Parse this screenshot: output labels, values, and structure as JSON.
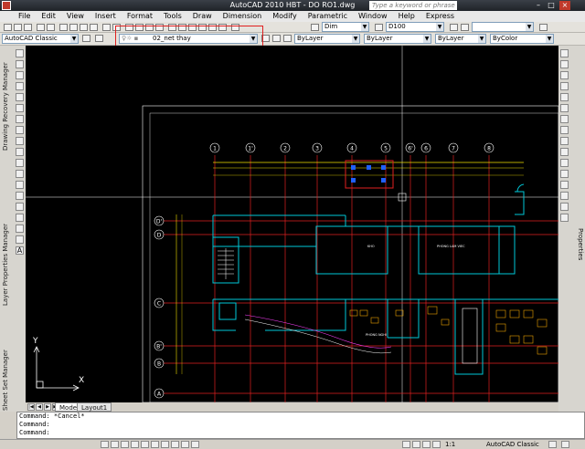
{
  "window": {
    "title": "AutoCAD 2010     HBT - DO RO1.dwg",
    "search_placeholder": "Type a keyword or phrase"
  },
  "menu": [
    "File",
    "Edit",
    "View",
    "Insert",
    "Format",
    "Tools",
    "Draw",
    "Dimension",
    "Modify",
    "Parametric",
    "Window",
    "Help",
    "Express"
  ],
  "toolbar": {
    "workspace": "AutoCAD Classic",
    "dimstyle": "Dim",
    "textstyle": "D100",
    "layer": "02_net thay",
    "color": "ByLayer",
    "linetype": "ByLayer",
    "lineweight": "ByLayer",
    "plotstyle": "ByColor"
  },
  "palettes": {
    "drawing_recovery": "Drawing Recovery Manager",
    "layer_properties": "Layer Properties Manager",
    "sheet_set": "Sheet Set Manager",
    "properties": "Properties",
    "text_tool": "A"
  },
  "drawing": {
    "grid_columns": [
      "1",
      "1'",
      "2",
      "3",
      "4",
      "5",
      "6'",
      "6",
      "7",
      "8"
    ],
    "grid_rows": [
      "D'",
      "D",
      "C",
      "B'",
      "B",
      "A"
    ],
    "ucs": {
      "x_label": "X",
      "y_label": "Y"
    },
    "room_labels": [
      "KHO",
      "PHONG LAM VIEC",
      "PHONG NGHI"
    ]
  },
  "tabs": [
    "Model",
    "Layout1"
  ],
  "command_lines": [
    "Command: *Cancel*",
    "Command:",
    "Command:"
  ],
  "status": {
    "scale": "1:1",
    "workspace": "AutoCAD Classic"
  },
  "colors": {
    "canvas": "#000000",
    "walls": "#00c8d8",
    "grid_lines": "#e02020",
    "dimensions": "#f0e000",
    "highlight": "#e02020",
    "grips": "#2060ff"
  }
}
